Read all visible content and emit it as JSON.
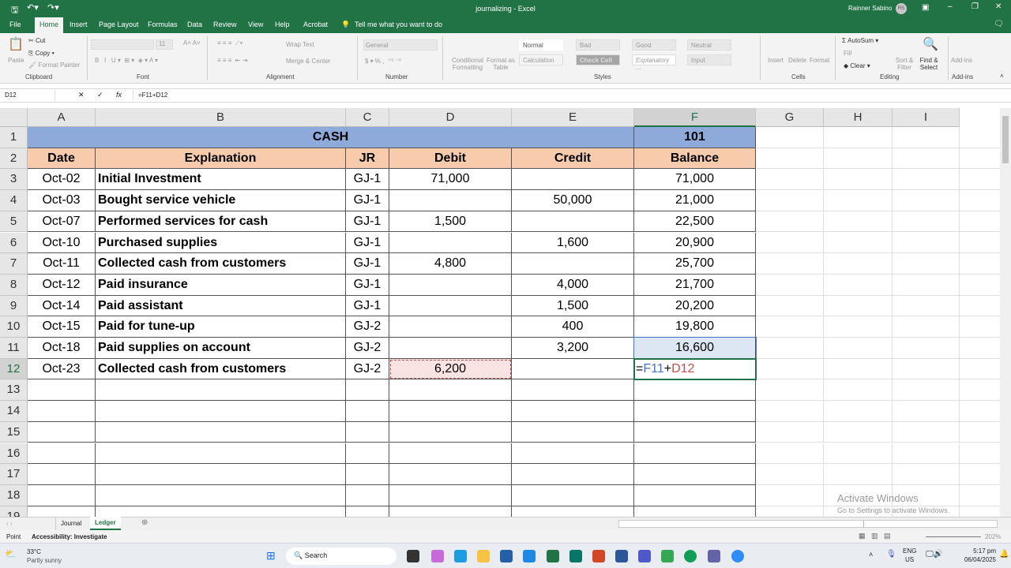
{
  "window": {
    "title": "journalizing - Excel",
    "user": "Rainner Sabino",
    "user_initials": "RS"
  },
  "ribbon_tabs": [
    "File",
    "Home",
    "Insert",
    "Page Layout",
    "Formulas",
    "Data",
    "Review",
    "View",
    "Help",
    "Acrobat"
  ],
  "tell_me": "Tell me what you want to do",
  "ribbon": {
    "clipboard": {
      "paste": "Paste",
      "cut": "Cut",
      "copy": "Copy",
      "format_painter": "Format Painter",
      "label": "Clipboard"
    },
    "font": {
      "size": "11",
      "label": "Font"
    },
    "alignment": {
      "wrap": "Wrap Text",
      "merge": "Merge & Center",
      "label": "Alignment"
    },
    "number": {
      "format": "General",
      "label": "Number"
    },
    "styles": {
      "conditional": "Conditional Formatting",
      "format_as_table": "Format as Table",
      "items": [
        "Normal",
        "Bad",
        "Good",
        "Neutral",
        "Calculation",
        "Check Cell",
        "Explanatory ...",
        "Input"
      ],
      "label": "Styles"
    },
    "cells": {
      "insert": "Insert",
      "delete": "Delete",
      "format": "Format",
      "label": "Cells"
    },
    "editing": {
      "autosum": "AutoSum",
      "fill": "Fill",
      "clear": "Clear",
      "sort": "Sort & Filter",
      "find": "Find & Select",
      "label": "Editing"
    },
    "addins": {
      "addins": "Add-ins",
      "label": "Add-ins"
    }
  },
  "formula_bar": {
    "name_box": "D12",
    "formula": "=F11+D12"
  },
  "columns": [
    "A",
    "B",
    "C",
    "D",
    "E",
    "F",
    "G",
    "H",
    "I"
  ],
  "sheet": {
    "title": "CASH",
    "account_no": "101",
    "headers": [
      "Date",
      "Explanation",
      "JR",
      "Debit",
      "Credit",
      "Balance"
    ],
    "rows": [
      [
        "Oct-02",
        "Initial Investment",
        "GJ-1",
        "71,000",
        "",
        "71,000"
      ],
      [
        "Oct-03",
        "Bought service vehicle",
        "GJ-1",
        "",
        "50,000",
        "21,000"
      ],
      [
        "Oct-07",
        "Performed services for cash",
        "GJ-1",
        "1,500",
        "",
        "22,500"
      ],
      [
        "Oct-10",
        "Purchased supplies",
        "GJ-1",
        "",
        "1,600",
        "20,900"
      ],
      [
        "Oct-11",
        "Collected cash from customers",
        "GJ-1",
        "4,800",
        "",
        "25,700"
      ],
      [
        "Oct-12",
        "Paid insurance",
        "GJ-1",
        "",
        "4,000",
        "21,700"
      ],
      [
        "Oct-14",
        "Paid assistant",
        "GJ-1",
        "",
        "1,500",
        "20,200"
      ],
      [
        "Oct-15",
        "Paid for tune-up",
        "GJ-2",
        "",
        "400",
        "19,800"
      ],
      [
        "Oct-18",
        "Paid supplies on account",
        "GJ-2",
        "",
        "3,200",
        "16,600"
      ],
      [
        "Oct-23",
        "Collected cash from customers",
        "GJ-2",
        "6,200",
        "",
        ""
      ]
    ],
    "editing_formula_parts": [
      "=",
      "F11",
      "+",
      "D12"
    ]
  },
  "colors": {
    "excel_green": "#217346",
    "title_fill": "#8eaadb",
    "header_fill": "#f8cbad",
    "ref_blue": "#4472c4",
    "ref_red": "#c0504d"
  },
  "sheet_tabs": [
    "Journal",
    "Ledger"
  ],
  "active_sheet": "Ledger",
  "status": {
    "mode": "Point",
    "accessibility": "Accessibility: Investigate",
    "zoom": "202%"
  },
  "watermark": {
    "line1": "Activate Windows",
    "line2": "Go to Settings to activate Windows."
  },
  "taskbar": {
    "weather_temp": "33°C",
    "weather_desc": "Partly sunny",
    "search": "Search",
    "lang1": "ENG",
    "lang2": "US",
    "time": "5:17 pm",
    "date": "06/04/2025"
  }
}
